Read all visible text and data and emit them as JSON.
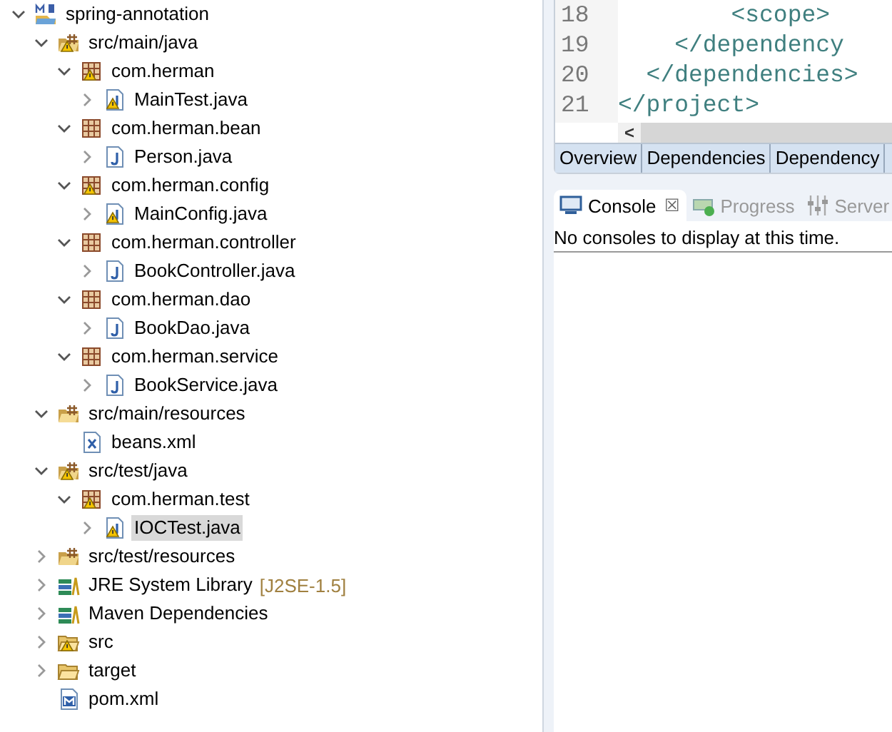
{
  "project_explorer": {
    "tree": [
      {
        "label": "spring-annotation",
        "kind": "project",
        "expanded": true,
        "warning": false,
        "selected": false,
        "children": [
          {
            "label": "src/main/java",
            "kind": "source-folder",
            "expanded": true,
            "warning": true,
            "selected": false,
            "children": [
              {
                "label": "com.herman",
                "kind": "package",
                "expanded": true,
                "warning": true,
                "selected": false,
                "children": [
                  {
                    "label": "MainTest.java",
                    "kind": "java",
                    "expanded": false,
                    "warning": true,
                    "selected": false
                  }
                ]
              },
              {
                "label": "com.herman.bean",
                "kind": "package",
                "expanded": true,
                "warning": false,
                "selected": false,
                "children": [
                  {
                    "label": "Person.java",
                    "kind": "java",
                    "expanded": false,
                    "warning": false,
                    "selected": false
                  }
                ]
              },
              {
                "label": "com.herman.config",
                "kind": "package",
                "expanded": true,
                "warning": true,
                "selected": false,
                "children": [
                  {
                    "label": "MainConfig.java",
                    "kind": "java",
                    "expanded": false,
                    "warning": true,
                    "selected": false
                  }
                ]
              },
              {
                "label": "com.herman.controller",
                "kind": "package",
                "expanded": true,
                "warning": false,
                "selected": false,
                "children": [
                  {
                    "label": "BookController.java",
                    "kind": "java",
                    "expanded": false,
                    "warning": false,
                    "selected": false
                  }
                ]
              },
              {
                "label": "com.herman.dao",
                "kind": "package",
                "expanded": true,
                "warning": false,
                "selected": false,
                "children": [
                  {
                    "label": "BookDao.java",
                    "kind": "java",
                    "expanded": false,
                    "warning": false,
                    "selected": false
                  }
                ]
              },
              {
                "label": "com.herman.service",
                "kind": "package",
                "expanded": true,
                "warning": false,
                "selected": false,
                "children": [
                  {
                    "label": "BookService.java",
                    "kind": "java",
                    "expanded": false,
                    "warning": false,
                    "selected": false
                  }
                ]
              }
            ]
          },
          {
            "label": "src/main/resources",
            "kind": "resource-folder",
            "expanded": true,
            "warning": false,
            "selected": false,
            "children": [
              {
                "label": "beans.xml",
                "kind": "xml",
                "warning": false,
                "selected": false
              }
            ]
          },
          {
            "label": "src/test/java",
            "kind": "source-folder",
            "expanded": true,
            "warning": true,
            "selected": false,
            "children": [
              {
                "label": "com.herman.test",
                "kind": "package",
                "expanded": true,
                "warning": true,
                "selected": false,
                "children": [
                  {
                    "label": "IOCTest.java",
                    "kind": "java",
                    "expanded": false,
                    "warning": true,
                    "selected": true
                  }
                ]
              }
            ]
          },
          {
            "label": "src/test/resources",
            "kind": "source-folder",
            "expanded": false,
            "warning": false,
            "selected": false
          },
          {
            "label": "JRE System Library",
            "decoration": "[J2SE-1.5]",
            "kind": "library",
            "expanded": false,
            "warning": false,
            "selected": false
          },
          {
            "label": "Maven Dependencies",
            "kind": "library",
            "expanded": false,
            "warning": false,
            "selected": false
          },
          {
            "label": "src",
            "kind": "folder",
            "expanded": false,
            "warning": true,
            "selected": false
          },
          {
            "label": "target",
            "kind": "folder",
            "expanded": false,
            "warning": false,
            "selected": false
          },
          {
            "label": "pom.xml",
            "kind": "maven-pom",
            "warning": false,
            "selected": false
          }
        ]
      }
    ]
  },
  "editor": {
    "lines": [
      {
        "number": "18",
        "code": "        <scope>"
      },
      {
        "number": "19",
        "code": "    </dependency"
      },
      {
        "number": "20",
        "code": "  </dependencies>"
      },
      {
        "number": "21",
        "code": "</project>"
      }
    ],
    "scroll_arrow": "<",
    "tabs": [
      {
        "label": "Overview",
        "selected": false
      },
      {
        "label": "Dependencies",
        "selected": false
      },
      {
        "label": "Dependency",
        "selected": false
      }
    ]
  },
  "console_view": {
    "tabs": [
      {
        "label": "Console",
        "kind": "console",
        "selected": true,
        "close": "☒"
      },
      {
        "label": "Progress",
        "kind": "progress",
        "selected": false
      },
      {
        "label": "Server",
        "kind": "servers",
        "selected": false
      }
    ],
    "message": "No consoles to display at this time."
  }
}
